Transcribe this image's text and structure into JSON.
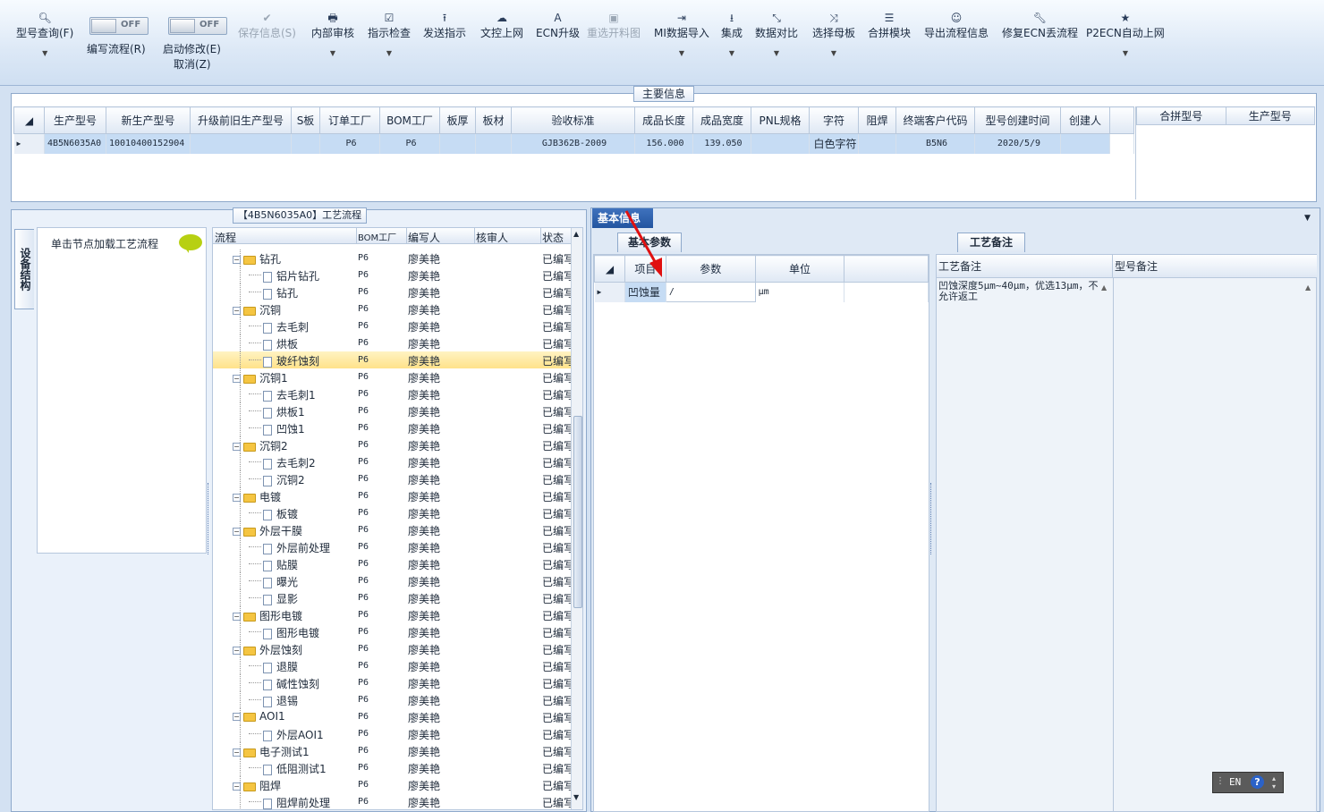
{
  "toolbar": {
    "items": [
      {
        "label": "型号查询(F)",
        "icon": "search-icon",
        "glyph": "🔍︎",
        "disabled": false,
        "dropdown": true
      },
      {
        "label": "保存信息(S)",
        "icon": "check-icon",
        "glyph": "✔",
        "disabled": true,
        "dropdown": false
      },
      {
        "label": "内部审核",
        "icon": "printer-icon",
        "glyph": "🖶",
        "disabled": false,
        "dropdown": true
      },
      {
        "label": "指示检查",
        "icon": "checkbox-icon",
        "glyph": "☑",
        "disabled": false,
        "dropdown": true
      },
      {
        "label": "发送指示",
        "icon": "upload-icon",
        "glyph": "⭱",
        "disabled": false,
        "dropdown": false
      },
      {
        "label": "文控上网",
        "icon": "cloud-upload-icon",
        "glyph": "☁",
        "disabled": false,
        "dropdown": false
      },
      {
        "label": "ECN升级",
        "icon": "font-icon",
        "glyph": "A",
        "disabled": false,
        "dropdown": false
      },
      {
        "label": "重选开料图",
        "icon": "image-icon",
        "glyph": "▣",
        "disabled": true,
        "dropdown": false
      },
      {
        "label": "MI数据导入",
        "icon": "sign-in-icon",
        "glyph": "⇥",
        "disabled": false,
        "dropdown": true
      },
      {
        "label": "集成",
        "icon": "download-icon",
        "glyph": "⭳",
        "disabled": false,
        "dropdown": true
      },
      {
        "label": "数据对比",
        "icon": "compress-icon",
        "glyph": "⤡",
        "disabled": false,
        "dropdown": true
      },
      {
        "label": "选择母板",
        "icon": "shuffle-icon",
        "glyph": "⤨",
        "disabled": false,
        "dropdown": true
      },
      {
        "label": "合拼模块",
        "icon": "list-icon",
        "glyph": "☰",
        "disabled": false,
        "dropdown": false
      },
      {
        "label": "导出流程信息",
        "icon": "smile-icon",
        "glyph": "☺",
        "disabled": false,
        "dropdown": false
      },
      {
        "label": "修复ECN丢流程",
        "icon": "wrench-icon",
        "glyph": "🔧︎",
        "disabled": false,
        "dropdown": false
      },
      {
        "label": "P2ECN自动上网",
        "icon": "star-icon",
        "glyph": "★",
        "disabled": false,
        "dropdown": true
      }
    ],
    "toggles": [
      {
        "state": "OFF",
        "label": "编写流程(R)"
      },
      {
        "state": "OFF",
        "label": "启动修改(E)",
        "label2": "取消(Z)"
      }
    ]
  },
  "main_info": {
    "title": "主要信息",
    "columns": [
      "生产型号",
      "新生产型号",
      "升级前旧生产型号",
      "S板",
      "订单工厂",
      "BOM工厂",
      "板厚",
      "板材",
      "验收标准",
      "成品长度",
      "成品宽度",
      "PNL规格",
      "字符",
      "阻焊",
      "终端客户代码",
      "型号创建时间",
      "创建人"
    ],
    "row": [
      "4B5N6035A0",
      "10010400152904",
      "",
      "",
      "P6",
      "P6",
      "",
      "",
      "GJB362B-2009",
      "156.000",
      "139.050",
      "",
      "白色字符",
      "",
      "B5N6",
      "2020/5/9",
      ""
    ],
    "merge_columns": [
      "合拼型号",
      "生产型号"
    ]
  },
  "process": {
    "title": "【4B5N6035A0】工艺流程",
    "side_tab": "设备结构",
    "hint": "单击节点加载工艺流程",
    "columns": [
      "流程",
      "BOM工厂",
      "编写人",
      "核审人",
      "状态"
    ],
    "rows": [
      {
        "name": "钻孔",
        "level": 0,
        "bom": "P6",
        "writer": "廖美艳",
        "status": "已编写"
      },
      {
        "name": "铝片钻孔",
        "level": 1,
        "bom": "P6",
        "writer": "廖美艳",
        "status": "已编写"
      },
      {
        "name": "钻孔",
        "level": 1,
        "bom": "P6",
        "writer": "廖美艳",
        "status": "已编写"
      },
      {
        "name": "沉铜",
        "level": 0,
        "bom": "P6",
        "writer": "廖美艳",
        "status": "已编写"
      },
      {
        "name": "去毛刺",
        "level": 1,
        "bom": "P6",
        "writer": "廖美艳",
        "status": "已编写"
      },
      {
        "name": "烘板",
        "level": 1,
        "bom": "P6",
        "writer": "廖美艳",
        "status": "已编写"
      },
      {
        "name": "玻纤蚀刻",
        "level": 1,
        "bom": "P6",
        "writer": "廖美艳",
        "status": "已编写",
        "selected": true
      },
      {
        "name": "沉铜1",
        "level": 0,
        "bom": "P6",
        "writer": "廖美艳",
        "status": "已编写"
      },
      {
        "name": "去毛刺1",
        "level": 1,
        "bom": "P6",
        "writer": "廖美艳",
        "status": "已编写"
      },
      {
        "name": "烘板1",
        "level": 1,
        "bom": "P6",
        "writer": "廖美艳",
        "status": "已编写"
      },
      {
        "name": "凹蚀1",
        "level": 1,
        "bom": "P6",
        "writer": "廖美艳",
        "status": "已编写"
      },
      {
        "name": "沉铜2",
        "level": 0,
        "bom": "P6",
        "writer": "廖美艳",
        "status": "已编写"
      },
      {
        "name": "去毛刺2",
        "level": 1,
        "bom": "P6",
        "writer": "廖美艳",
        "status": "已编写"
      },
      {
        "name": "沉铜2",
        "level": 1,
        "bom": "P6",
        "writer": "廖美艳",
        "status": "已编写"
      },
      {
        "name": "电镀",
        "level": 0,
        "bom": "P6",
        "writer": "廖美艳",
        "status": "已编写"
      },
      {
        "name": "板镀",
        "level": 1,
        "bom": "P6",
        "writer": "廖美艳",
        "status": "已编写"
      },
      {
        "name": "外层干膜",
        "level": 0,
        "bom": "P6",
        "writer": "廖美艳",
        "status": "已编写"
      },
      {
        "name": "外层前处理",
        "level": 1,
        "bom": "P6",
        "writer": "廖美艳",
        "status": "已编写"
      },
      {
        "name": "贴膜",
        "level": 1,
        "bom": "P6",
        "writer": "廖美艳",
        "status": "已编写"
      },
      {
        "name": "曝光",
        "level": 1,
        "bom": "P6",
        "writer": "廖美艳",
        "status": "已编写"
      },
      {
        "name": "显影",
        "level": 1,
        "bom": "P6",
        "writer": "廖美艳",
        "status": "已编写"
      },
      {
        "name": "图形电镀",
        "level": 0,
        "bom": "P6",
        "writer": "廖美艳",
        "status": "已编写"
      },
      {
        "name": "图形电镀",
        "level": 1,
        "bom": "P6",
        "writer": "廖美艳",
        "status": "已编写"
      },
      {
        "name": "外层蚀刻",
        "level": 0,
        "bom": "P6",
        "writer": "廖美艳",
        "status": "已编写"
      },
      {
        "name": "退膜",
        "level": 1,
        "bom": "P6",
        "writer": "廖美艳",
        "status": "已编写"
      },
      {
        "name": "碱性蚀刻",
        "level": 1,
        "bom": "P6",
        "writer": "廖美艳",
        "status": "已编写"
      },
      {
        "name": "退锡",
        "level": 1,
        "bom": "P6",
        "writer": "廖美艳",
        "status": "已编写"
      },
      {
        "name": "AOI1",
        "level": 0,
        "bom": "P6",
        "writer": "廖美艳",
        "status": "已编写"
      },
      {
        "name": "外层AOI1",
        "level": 1,
        "bom": "P6",
        "writer": "廖美艳",
        "status": "已编写"
      },
      {
        "name": "电子测试1",
        "level": 0,
        "bom": "P6",
        "writer": "廖美艳",
        "status": "已编写"
      },
      {
        "name": "低阻测试1",
        "level": 1,
        "bom": "P6",
        "writer": "廖美艳",
        "status": "已编写"
      },
      {
        "name": "阻焊",
        "level": 0,
        "bom": "P6",
        "writer": "廖美艳",
        "status": "已编写"
      },
      {
        "name": "阻焊前处理",
        "level": 1,
        "bom": "P6",
        "writer": "廖美艳",
        "status": "已编写"
      }
    ]
  },
  "basic": {
    "tab": "基本信息",
    "sub_tab": "基本参数",
    "columns": [
      "项目",
      "参数",
      "单位"
    ],
    "row": [
      "凹蚀量",
      "/",
      "μm"
    ]
  },
  "notes": {
    "tab": "工艺备注",
    "col1": "工艺备注",
    "col2": "型号备注",
    "text": "凹蚀深度5μm~40μm，优选13μm，不允许返工"
  },
  "lang": {
    "code": "EN"
  }
}
